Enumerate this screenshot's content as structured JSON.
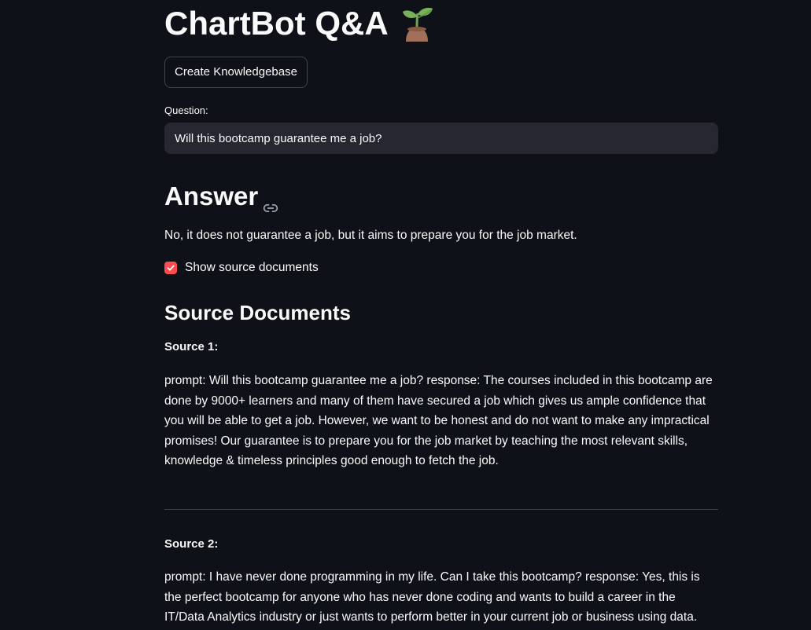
{
  "header": {
    "title": "ChartBot Q&A",
    "title_icon": "seedling-icon"
  },
  "actions": {
    "create_kb_label": "Create Knowledgebase"
  },
  "question": {
    "label": "Question:",
    "value": "Will this bootcamp guarantee me a job?"
  },
  "answer": {
    "heading": "Answer",
    "anchor_icon": "link-icon",
    "text": "No, it does not guarantee a job, but it aims to prepare you for the job market."
  },
  "show_sources": {
    "label": "Show source documents",
    "checked": true
  },
  "sources": {
    "heading": "Source Documents",
    "items": [
      {
        "label": "Source 1:",
        "text": "prompt: Will this bootcamp guarantee me a job? response: The courses included in this bootcamp are done by 9000+ learners and many of them have secured a job which gives us ample confidence that you will be able to get a job. However, we want to be honest and do not want to make any impractical promises! Our guarantee is to prepare you for the job market by teaching the most relevant skills, knowledge & timeless principles good enough to fetch the job."
      },
      {
        "label": "Source 2:",
        "text": "prompt: I have never done programming in my life. Can I take this bootcamp? response: Yes, this is the perfect bootcamp for anyone who has never done coding and wants to build a career in the IT/Data Analytics industry or just wants to perform better in your current job or business using data."
      }
    ]
  },
  "colors": {
    "background": "#0e1117",
    "input_background": "#262730",
    "accent": "#ff4b4b",
    "text": "#fafafa"
  }
}
